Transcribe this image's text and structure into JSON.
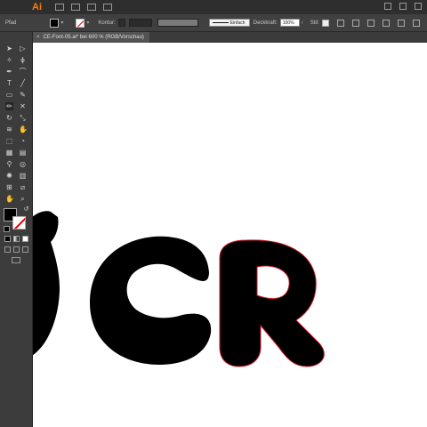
{
  "app": {
    "logo_text": "Ai",
    "accent": "#ff7c00"
  },
  "control_bar": {
    "object_label": "Pfad",
    "stroke_label": "Kontur:",
    "stroke_style": "Einfach",
    "opacity_label": "Deckkraft:",
    "opacity_value": "100%",
    "style_label": "Stil:"
  },
  "document_tab": {
    "title": "CE-Font-05.ai* bei 600 % (RGB/Vorschau)",
    "close_glyph": "×"
  },
  "canvas": {
    "artwork_letters": [
      "S",
      "C",
      "R"
    ],
    "fill_color": "#000000",
    "selection_color": "#d21d2b",
    "background": "#ffffff"
  },
  "toolbar": {
    "tools": [
      "selection-tool",
      "direct-selection-tool",
      "magic-wand-tool",
      "lasso-tool",
      "pen-tool",
      "curvature-tool",
      "type-tool",
      "line-tool",
      "rectangle-tool",
      "paintbrush-tool",
      "pencil-tool",
      "shaper-tool",
      "rotate-tool",
      "scale-tool",
      "width-tool",
      "warp-tool",
      "free-transform-tool",
      "shape-builder-tool",
      "perspective-grid-tool",
      "mesh-tool",
      "gradient-tool",
      "eyedropper-tool",
      "blend-tool",
      "symbol-sprayer-tool",
      "column-graph-tool",
      "artboard-tool",
      "slice-tool",
      "hand-tool",
      "zoom-tool"
    ],
    "active_tool": "pencil-tool",
    "fill_swatch": "#000000",
    "stroke_swatch": "none"
  }
}
